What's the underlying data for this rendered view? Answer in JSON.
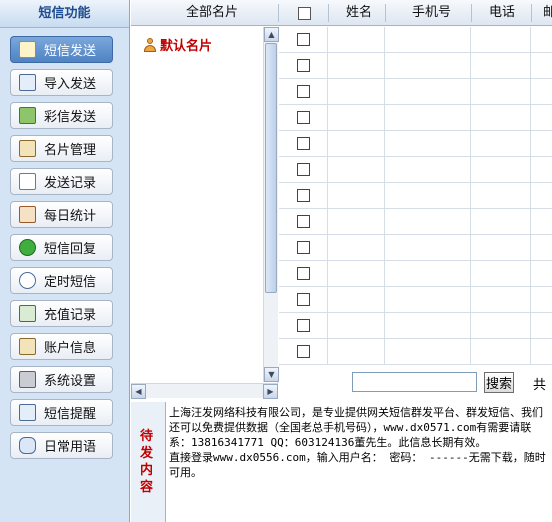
{
  "sidebar": {
    "title": "短信功能",
    "items": [
      {
        "label": "短信发送",
        "icon": "envelope-icon",
        "active": true
      },
      {
        "label": "导入发送",
        "icon": "import-icon"
      },
      {
        "label": "彩信发送",
        "icon": "mms-image-icon"
      },
      {
        "label": "名片管理",
        "icon": "card-manage-icon"
      },
      {
        "label": "发送记录",
        "icon": "document-icon"
      },
      {
        "label": "每日统计",
        "icon": "calendar-icon"
      },
      {
        "label": "短信回复",
        "icon": "power-reply-icon"
      },
      {
        "label": "定时短信",
        "icon": "clock-icon"
      },
      {
        "label": "充值记录",
        "icon": "ledger-icon"
      },
      {
        "label": "账户信息",
        "icon": "account-icon"
      },
      {
        "label": "系统设置",
        "icon": "wrench-icon"
      },
      {
        "label": "短信提醒",
        "icon": "reminder-icon"
      },
      {
        "label": "日常用语",
        "icon": "chat-bubbles-icon"
      }
    ]
  },
  "header": {
    "all_cards": "全部名片",
    "name": "姓名",
    "mobile": "手机号",
    "phone": "电话",
    "extra": "邮"
  },
  "tree": {
    "default_group": "默认名片"
  },
  "grid": {
    "row_count": 13
  },
  "search": {
    "value": "",
    "button": "搜索",
    "total": "共"
  },
  "pending": {
    "label": "待发内容",
    "text": "上海汪发网络科技有限公司，是专业提供网关短信群发平台、群发短信、我们还可以免费提供数据（全国老总手机号码），www.dx0571.com有需要请联系：13816341771 QQ：603124136董先生。此信息长期有效。\n直接登录www.dx0556.com，输入用户名： 密码： ------无需下载，随时可用。"
  },
  "colors": {
    "sidebar_bg": "#d5e4f4",
    "active_button": "#4f83c3",
    "accent_red": "#c00000"
  }
}
